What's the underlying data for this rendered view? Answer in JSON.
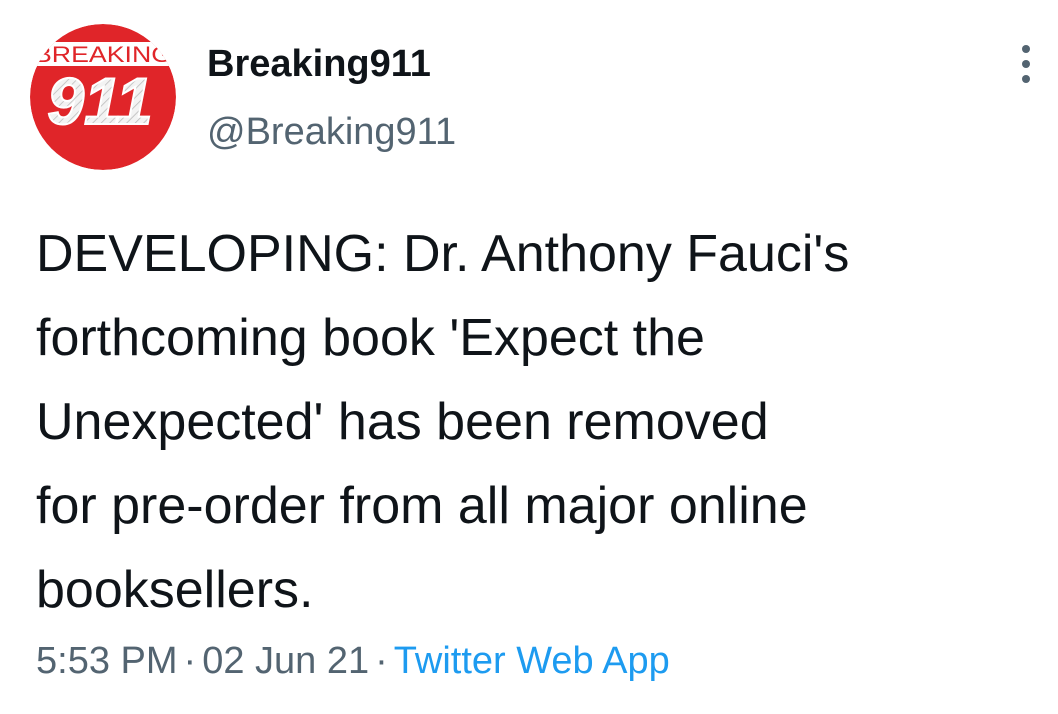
{
  "avatar": {
    "top_text": "BREAKING",
    "number_text": "911",
    "color": "#e02529"
  },
  "author": {
    "display_name": "Breaking911",
    "handle": "@Breaking911"
  },
  "menu": {
    "icon": "more-vertical-icon"
  },
  "tweet": {
    "text": "DEVELOPING: Dr. Anthony Fauci's\nforthcoming book 'Expect the\nUnexpected' has been removed\nfor pre-order from all major online\nbooksellers."
  },
  "meta": {
    "time": "5:53 PM",
    "separator": "·",
    "date": "02 Jun 21",
    "source": "Twitter Web App"
  },
  "colors": {
    "text": "#0f1419",
    "secondary": "#536471",
    "link": "#1d9bf0"
  }
}
